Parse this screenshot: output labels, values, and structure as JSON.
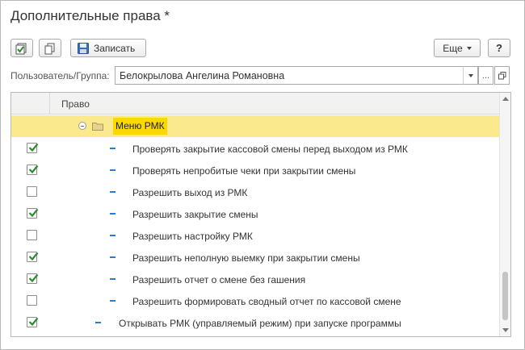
{
  "window": {
    "title": "Дополнительные права *"
  },
  "toolbar": {
    "save_label": "Записать",
    "more_label": "Еще",
    "help_label": "?"
  },
  "user_group": {
    "label": "Пользователь/Группа:",
    "value": "Белокрылова Ангелина Романовна",
    "dots_label": "..."
  },
  "table": {
    "header": {
      "right_column": "Право"
    },
    "folder": {
      "label": "Меню РМК"
    },
    "rows": [
      {
        "label": "Проверять закрытие кассовой смены перед выходом из РМК",
        "checked": true
      },
      {
        "label": "Проверять непробитые чеки при закрытии смены",
        "checked": true
      },
      {
        "label": "Разрешить выход из РМК",
        "checked": false
      },
      {
        "label": "Разрешить закрытие смены",
        "checked": true
      },
      {
        "label": "Разрешить настройку РМК",
        "checked": false
      },
      {
        "label": "Разрешить неполную выемку при закрытии смены",
        "checked": true
      },
      {
        "label": "Разрешить отчет о смене без гашения",
        "checked": true
      },
      {
        "label": "Разрешить формировать сводный отчет по кассовой смене",
        "checked": false
      },
      {
        "label": "Открывать РМК (управляемый режим) при запуске программы",
        "checked": true
      }
    ]
  },
  "colors": {
    "selection": "#fbe98d",
    "highlight": "#f9d900",
    "check": "#2e8b2e",
    "dash": "#2a7cd3"
  }
}
